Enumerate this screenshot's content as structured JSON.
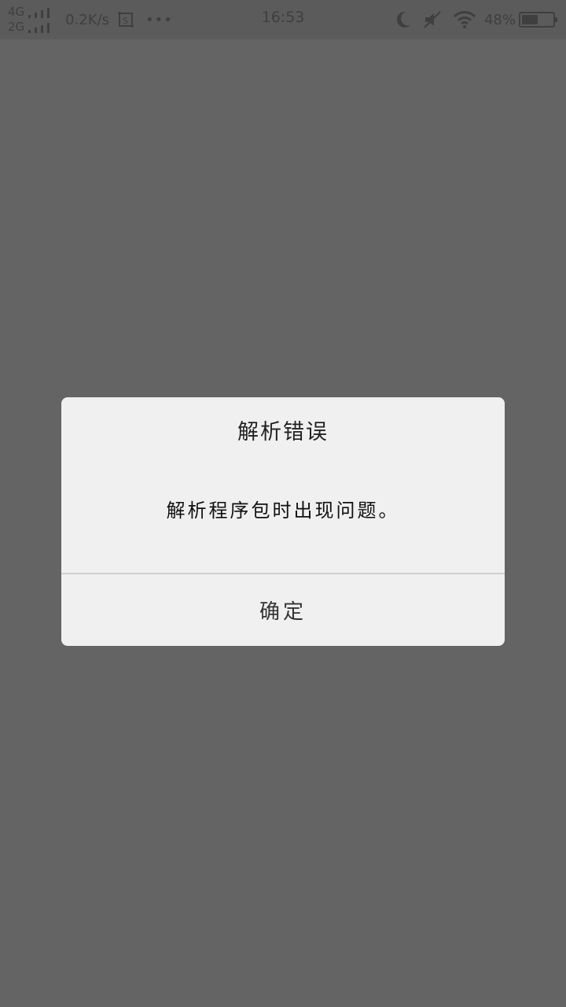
{
  "status_bar": {
    "network_1": "4G",
    "network_2": "2G",
    "speed": "0.2K/s",
    "more": "•••",
    "time": "16:53",
    "battery_percent": "48%",
    "battery_level": 0.48
  },
  "dialog": {
    "title": "解析错误",
    "message": "解析程序包时出现问题。",
    "ok_label": "确定"
  },
  "colors": {
    "overlay": "#646464",
    "dialog_bg": "#f0f0f0",
    "status_icon": "#3f3f3f"
  },
  "icons": [
    "signal-icon",
    "screenshot-icon",
    "moon-icon",
    "mute-icon",
    "wifi-icon",
    "battery-icon"
  ]
}
